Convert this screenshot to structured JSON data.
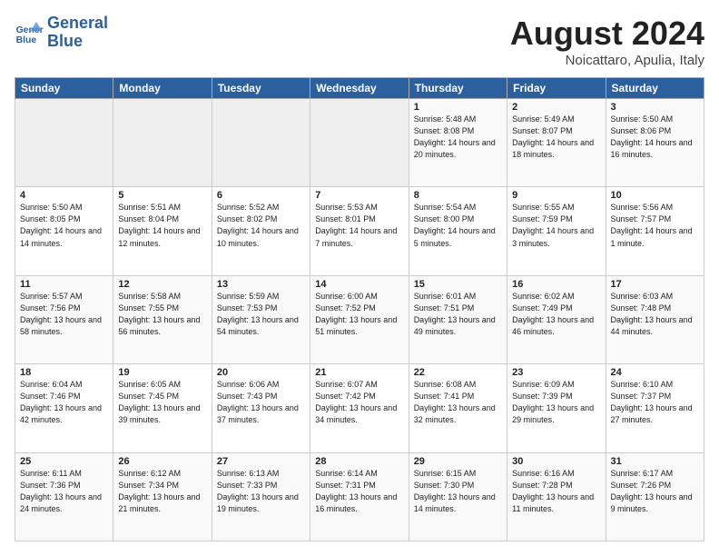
{
  "header": {
    "logo_line1": "General",
    "logo_line2": "Blue",
    "month": "August 2024",
    "location": "Noicattaro, Apulia, Italy"
  },
  "weekdays": [
    "Sunday",
    "Monday",
    "Tuesday",
    "Wednesday",
    "Thursday",
    "Friday",
    "Saturday"
  ],
  "weeks": [
    [
      {
        "day": "",
        "info": ""
      },
      {
        "day": "",
        "info": ""
      },
      {
        "day": "",
        "info": ""
      },
      {
        "day": "",
        "info": ""
      },
      {
        "day": "1",
        "info": "Sunrise: 5:48 AM\nSunset: 8:08 PM\nDaylight: 14 hours\nand 20 minutes."
      },
      {
        "day": "2",
        "info": "Sunrise: 5:49 AM\nSunset: 8:07 PM\nDaylight: 14 hours\nand 18 minutes."
      },
      {
        "day": "3",
        "info": "Sunrise: 5:50 AM\nSunset: 8:06 PM\nDaylight: 14 hours\nand 16 minutes."
      }
    ],
    [
      {
        "day": "4",
        "info": "Sunrise: 5:50 AM\nSunset: 8:05 PM\nDaylight: 14 hours\nand 14 minutes."
      },
      {
        "day": "5",
        "info": "Sunrise: 5:51 AM\nSunset: 8:04 PM\nDaylight: 14 hours\nand 12 minutes."
      },
      {
        "day": "6",
        "info": "Sunrise: 5:52 AM\nSunset: 8:02 PM\nDaylight: 14 hours\nand 10 minutes."
      },
      {
        "day": "7",
        "info": "Sunrise: 5:53 AM\nSunset: 8:01 PM\nDaylight: 14 hours\nand 7 minutes."
      },
      {
        "day": "8",
        "info": "Sunrise: 5:54 AM\nSunset: 8:00 PM\nDaylight: 14 hours\nand 5 minutes."
      },
      {
        "day": "9",
        "info": "Sunrise: 5:55 AM\nSunset: 7:59 PM\nDaylight: 14 hours\nand 3 minutes."
      },
      {
        "day": "10",
        "info": "Sunrise: 5:56 AM\nSunset: 7:57 PM\nDaylight: 14 hours\nand 1 minute."
      }
    ],
    [
      {
        "day": "11",
        "info": "Sunrise: 5:57 AM\nSunset: 7:56 PM\nDaylight: 13 hours\nand 58 minutes."
      },
      {
        "day": "12",
        "info": "Sunrise: 5:58 AM\nSunset: 7:55 PM\nDaylight: 13 hours\nand 56 minutes."
      },
      {
        "day": "13",
        "info": "Sunrise: 5:59 AM\nSunset: 7:53 PM\nDaylight: 13 hours\nand 54 minutes."
      },
      {
        "day": "14",
        "info": "Sunrise: 6:00 AM\nSunset: 7:52 PM\nDaylight: 13 hours\nand 51 minutes."
      },
      {
        "day": "15",
        "info": "Sunrise: 6:01 AM\nSunset: 7:51 PM\nDaylight: 13 hours\nand 49 minutes."
      },
      {
        "day": "16",
        "info": "Sunrise: 6:02 AM\nSunset: 7:49 PM\nDaylight: 13 hours\nand 46 minutes."
      },
      {
        "day": "17",
        "info": "Sunrise: 6:03 AM\nSunset: 7:48 PM\nDaylight: 13 hours\nand 44 minutes."
      }
    ],
    [
      {
        "day": "18",
        "info": "Sunrise: 6:04 AM\nSunset: 7:46 PM\nDaylight: 13 hours\nand 42 minutes."
      },
      {
        "day": "19",
        "info": "Sunrise: 6:05 AM\nSunset: 7:45 PM\nDaylight: 13 hours\nand 39 minutes."
      },
      {
        "day": "20",
        "info": "Sunrise: 6:06 AM\nSunset: 7:43 PM\nDaylight: 13 hours\nand 37 minutes."
      },
      {
        "day": "21",
        "info": "Sunrise: 6:07 AM\nSunset: 7:42 PM\nDaylight: 13 hours\nand 34 minutes."
      },
      {
        "day": "22",
        "info": "Sunrise: 6:08 AM\nSunset: 7:41 PM\nDaylight: 13 hours\nand 32 minutes."
      },
      {
        "day": "23",
        "info": "Sunrise: 6:09 AM\nSunset: 7:39 PM\nDaylight: 13 hours\nand 29 minutes."
      },
      {
        "day": "24",
        "info": "Sunrise: 6:10 AM\nSunset: 7:37 PM\nDaylight: 13 hours\nand 27 minutes."
      }
    ],
    [
      {
        "day": "25",
        "info": "Sunrise: 6:11 AM\nSunset: 7:36 PM\nDaylight: 13 hours\nand 24 minutes."
      },
      {
        "day": "26",
        "info": "Sunrise: 6:12 AM\nSunset: 7:34 PM\nDaylight: 13 hours\nand 21 minutes."
      },
      {
        "day": "27",
        "info": "Sunrise: 6:13 AM\nSunset: 7:33 PM\nDaylight: 13 hours\nand 19 minutes."
      },
      {
        "day": "28",
        "info": "Sunrise: 6:14 AM\nSunset: 7:31 PM\nDaylight: 13 hours\nand 16 minutes."
      },
      {
        "day": "29",
        "info": "Sunrise: 6:15 AM\nSunset: 7:30 PM\nDaylight: 13 hours\nand 14 minutes."
      },
      {
        "day": "30",
        "info": "Sunrise: 6:16 AM\nSunset: 7:28 PM\nDaylight: 13 hours\nand 11 minutes."
      },
      {
        "day": "31",
        "info": "Sunrise: 6:17 AM\nSunset: 7:26 PM\nDaylight: 13 hours\nand 9 minutes."
      }
    ]
  ]
}
